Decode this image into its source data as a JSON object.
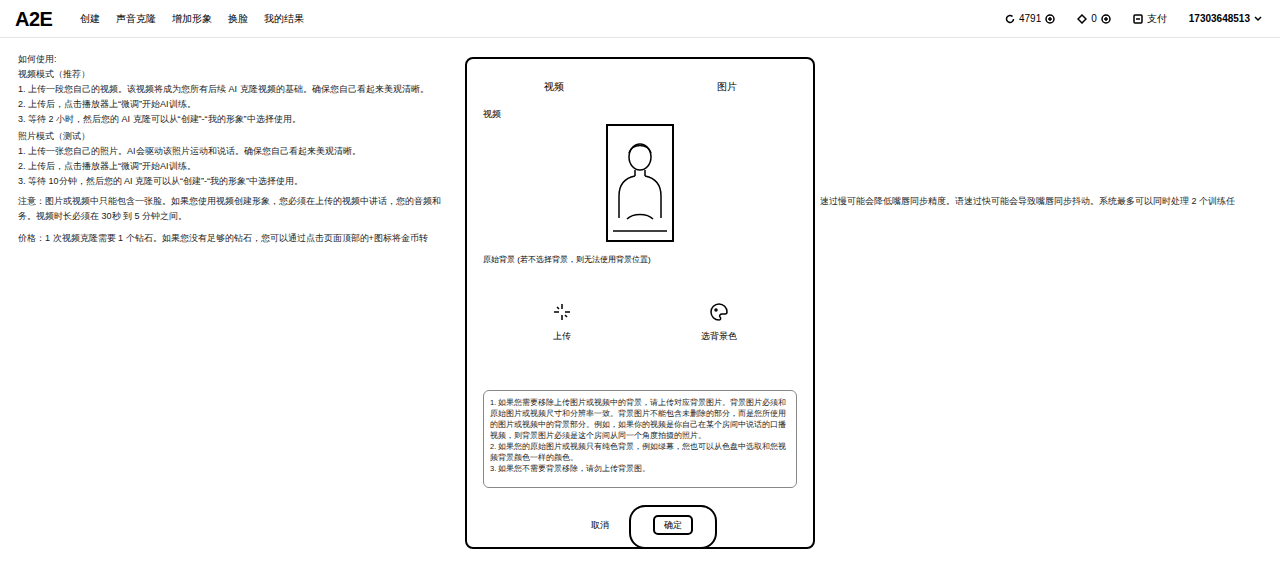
{
  "header": {
    "logo": "A2E",
    "nav": [
      {
        "label": "创建"
      },
      {
        "label": "声音克隆"
      },
      {
        "label": "增加形象"
      },
      {
        "label": "换脸"
      },
      {
        "label": "我的结果"
      }
    ],
    "coins": "4791",
    "diamonds": "0",
    "pay": "支付",
    "account": "17303648513"
  },
  "instructions": {
    "title": "如何使用:",
    "sections": [
      {
        "heading": "视频模式（推荐）",
        "steps": [
          "1. 上传一段您自己的视频。该视频将成为您所有后续 AI 克隆视频的基础。确保您自己看起来美观清晰。",
          "2. 上传后，点击播放器上“微调”开始AI训练。",
          "3. 等待 2 小时，然后您的 AI 克隆可以从“创建”-“我的形象”中选择使用。"
        ]
      },
      {
        "heading": "照片模式（测试）",
        "steps": [
          "1. 上传一张您自己的照片。AI会驱动该照片运动和说话。确保您自己看起来美观清晰。",
          "2. 上传后，点击播放器上“微调”开始AI训练。",
          "3. 等待 10分钟，然后您的 AI 克隆可以从“创建”-“我的形象”中选择使用。"
        ]
      }
    ],
    "note": {
      "left": "注意：图片或视频中只能包含一张脸。如果您使用视频创建形象，您必须在上传的视频中讲话，您的音频和",
      "right": "速过慢可能会降低嘴唇同步精度。语速过快可能会导致嘴唇同步抖动。系统最多可以同时处理 2 个训练任",
      "end": "务。视频时长必须在 30秒 到 5 分钟之间。"
    },
    "price": "价格：1 次视频克隆需要 1 个钻石。如果您没有足够的钻石，您可以通过点击页面顶部的+图标将金币转"
  },
  "modal": {
    "tabs": [
      {
        "label": "视频"
      },
      {
        "label": "图片"
      }
    ],
    "section_label": "视频",
    "background_label": "原始背景 (若不选择背景，则无法使用背景位置)",
    "actions": [
      {
        "label": "上传",
        "kind": "upload"
      },
      {
        "label": "选背景色",
        "kind": "color"
      }
    ],
    "tips": [
      "1. 如果您需要移除上传图片或视频中的背景，请上传对应背景图片。背景图片必须和原始图片或视频尺寸和分辨率一致。背景图片不能包含未删除的部分，而是您所使用的图片或视频中的背景部分。例如，如果你的视频是你自己在某个房间中说话的口播视频，则背景图片必须是这个房间从同一个角度拍摄的照片。",
      "2. 如果您的原始图片或视频只有纯色背景，例如绿幕，您也可以从色盘中选取和您视频背景颜色一样的颜色。",
      "3. 如果您不需要背景移除，请勿上传背景图。"
    ],
    "buttons": [
      {
        "label": "取消",
        "highlighted": false
      },
      {
        "label": "确定",
        "highlighted": true
      }
    ]
  }
}
